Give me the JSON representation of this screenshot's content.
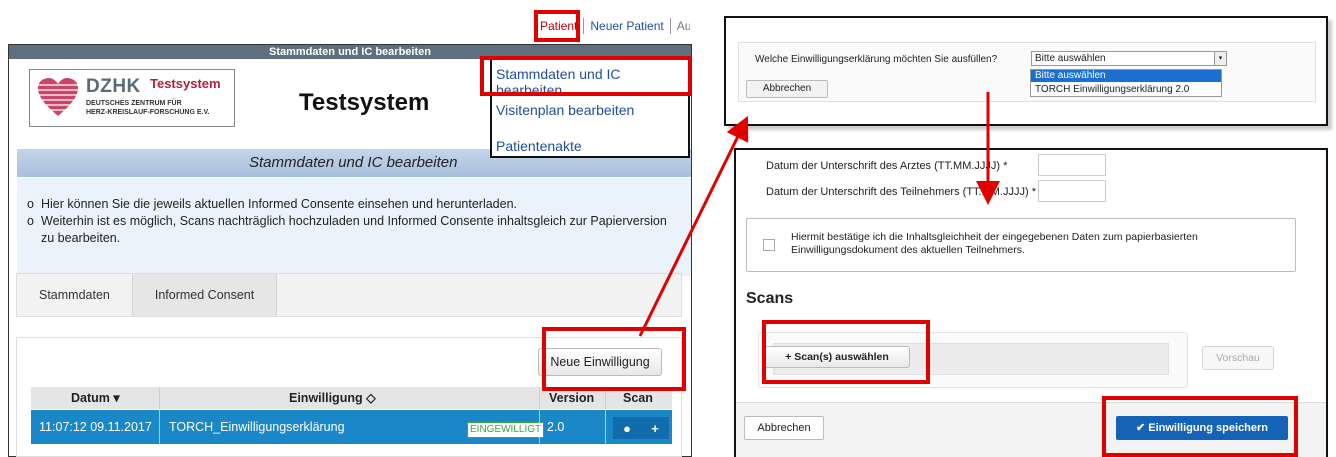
{
  "topnav": {
    "items": [
      "Patient",
      "Neuer Patient",
      "Ausw"
    ]
  },
  "left_panel": {
    "titlebar": "Stammdaten und IC bearbeiten",
    "logo": {
      "brand": "DZHK",
      "tag": "Testsystem",
      "line1": "DEUTSCHES ZENTRUM FÜR",
      "line2": "HERZ-KREISLAUF-FORSCHUNG E.V."
    },
    "site_title": "Testsystem",
    "band_title": "Stammdaten und IC bearbeiten",
    "info": [
      "Hier können Sie die jeweils aktuellen Informed Consente einsehen und herunterladen.",
      "Weiterhin ist es möglich, Scans nachträglich hochzuladen und Informed Consente inhaltsgleich zur Papierversion zu bearbeiten."
    ],
    "tabs": [
      "Stammdaten",
      "Informed Consent"
    ],
    "new_button": "Neue Einwilligung",
    "table": {
      "headers": [
        "Datum ▾",
        "Einwilligung ◇",
        "Version",
        "Scan"
      ],
      "row": {
        "datum": "11:07:12 09.11.2017",
        "einwilligung": "TORCH_Einwilligungserklärung",
        "status": "EINGEWILLIGT",
        "version": "2.0",
        "view_icon": "●",
        "add_icon": "+"
      }
    }
  },
  "dropdown_menu": {
    "items": [
      "Stammdaten und IC bearbeiten",
      "Visitenplan bearbeiten",
      "Patientenakte"
    ]
  },
  "right_top": {
    "question": "Welche Einwilligungserklärung möchten Sie ausfüllen?",
    "select_value": "Bitte auswählen",
    "select_arrow": "▾",
    "options": [
      "Bitte auswählen",
      "TORCH Einwilligungserklärung 2.0"
    ],
    "cancel": "Abbrechen"
  },
  "right_bottom": {
    "doctor_date_label": "Datum der Unterschrift des Arztes (TT.MM.JJJJ) *",
    "participant_date_label": "Datum der Unterschrift des Teilnehmers (TT.MM.JJJJ) *",
    "confirm_text": "Hiermit bestätige ich die Inhaltsgleichheit der eingegebenen Daten zum papierbasierten Einwilligungsdokument des aktuellen Teilnehmers.",
    "scans_title": "Scans",
    "upload_button": "+ Scan(s) auswählen",
    "preview_button": "Vorschau",
    "cancel": "Abbrechen",
    "save_button": "✔ Einwilligung speichern"
  },
  "colors": {
    "highlight": "#e00000",
    "row_blue": "#1a87c9",
    "save_blue": "#1463b6",
    "band_blue": "#b6c9e2"
  }
}
